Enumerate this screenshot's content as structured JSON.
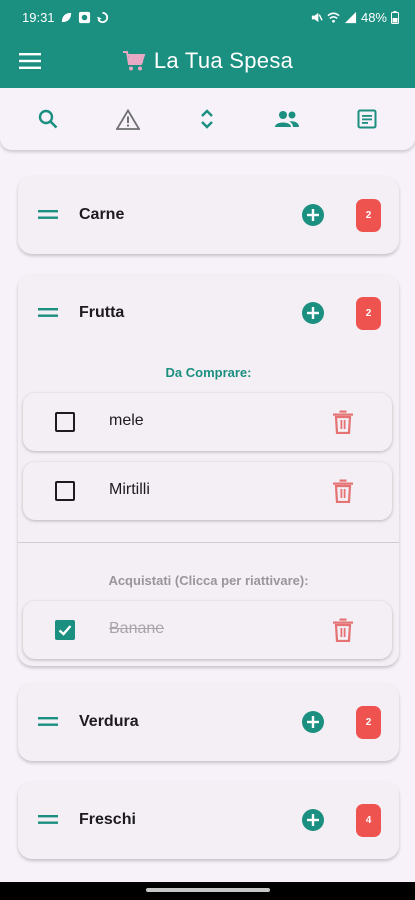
{
  "status": {
    "time": "19:31",
    "battery": "48%"
  },
  "app": {
    "title": "La Tua Spesa",
    "title_icon": "shopping-cart-icon"
  },
  "colors": {
    "primary": "#1b8f80",
    "badge": "#ef5350",
    "delete": "#e57373",
    "bought_text": "#a9a3ab"
  },
  "toolbar": [
    "search-icon",
    "warning-icon",
    "expand-collapse-icon",
    "people-icon",
    "list-icon"
  ],
  "categories": [
    {
      "name": "Carne",
      "count": "2"
    },
    {
      "name": "Frutta",
      "count": "2",
      "to_buy_label": "Da Comprare:",
      "to_buy": [
        {
          "name": "mele"
        },
        {
          "name": "Mirtilli"
        }
      ],
      "bought_label": "Acquistati (Clicca per riattivare):",
      "bought": [
        {
          "name": "Banane"
        }
      ]
    },
    {
      "name": "Verdura",
      "count": "2"
    },
    {
      "name": "Freschi",
      "count": "4"
    }
  ]
}
